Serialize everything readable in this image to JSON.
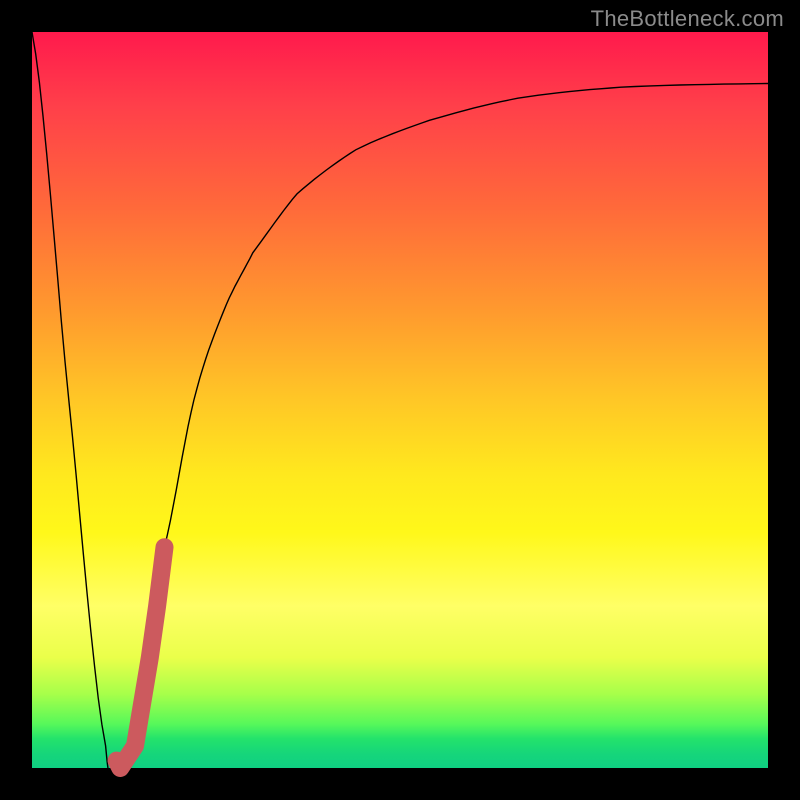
{
  "watermark": "TheBottleneck.com",
  "colors": {
    "frame": "#000000",
    "grad_top": "#ff1a4c",
    "grad_bottom": "#0fcf82",
    "curve": "#000000",
    "highlight": "#cc5a5e",
    "watermark": "#8b8b8b"
  },
  "chart_data": {
    "type": "line",
    "title": "",
    "xlabel": "",
    "ylabel": "",
    "xlim": [
      0,
      100
    ],
    "ylim": [
      0,
      100
    ],
    "series": [
      {
        "name": "bottleneck-curve",
        "x": [
          0,
          5,
          10,
          12,
          14,
          16,
          18,
          22,
          26,
          30,
          36,
          44,
          54,
          66,
          80,
          100
        ],
        "y": [
          100,
          50,
          3,
          0,
          7,
          18,
          30,
          50,
          62,
          70,
          78,
          84,
          88,
          91,
          92.5,
          93
        ]
      },
      {
        "name": "user-hardware-highlight",
        "x": [
          12,
          14,
          16,
          17,
          18
        ],
        "y": [
          0,
          3,
          15,
          22,
          30
        ]
      }
    ]
  }
}
